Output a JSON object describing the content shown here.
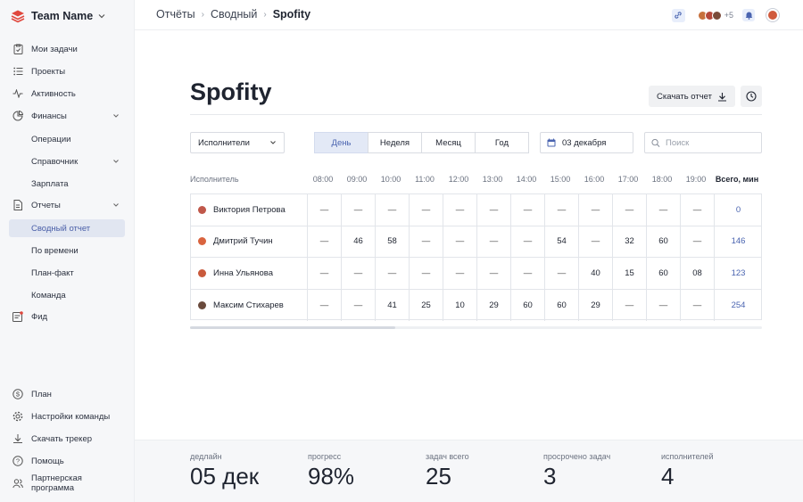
{
  "sidebar": {
    "team_name": "Team Name",
    "items": [
      {
        "label": "Мои задачи",
        "icon": "clipboard-icon"
      },
      {
        "label": "Проекты",
        "icon": "list-icon"
      },
      {
        "label": "Активность",
        "icon": "activity-icon"
      },
      {
        "label": "Финансы",
        "icon": "pie-icon"
      },
      {
        "label": "Операции"
      },
      {
        "label": "Справочник"
      },
      {
        "label": "Зарплата"
      },
      {
        "label": "Отчеты",
        "icon": "document-icon"
      },
      {
        "label": "Сводный отчет"
      },
      {
        "label": "По времени"
      },
      {
        "label": "План-факт"
      },
      {
        "label": "Команда"
      },
      {
        "label": "Фид",
        "icon": "feed-icon"
      }
    ],
    "bottom": [
      {
        "label": "План",
        "icon": "dollar-icon"
      },
      {
        "label": "Настройки команды",
        "icon": "gear-icon"
      },
      {
        "label": "Скачать трекер",
        "icon": "download-icon"
      },
      {
        "label": "Помощь",
        "icon": "help-icon"
      },
      {
        "label": "Партнерская программа",
        "icon": "users-icon"
      }
    ]
  },
  "topbar": {
    "breadcrumbs": [
      "Отчёты",
      "Сводный",
      "Spofity"
    ],
    "more_count": "+5"
  },
  "main": {
    "title": "Spofity",
    "download_label": "Скачать отчет",
    "filter_select": "Исполнители",
    "periods": [
      "День",
      "Неделя",
      "Месяц",
      "Год"
    ],
    "active_period": "День",
    "date": "03 декабря",
    "search_placeholder": "Поиск"
  },
  "table": {
    "headers": [
      "Исполнитель",
      "08:00",
      "09:00",
      "10:00",
      "11:00",
      "12:00",
      "13:00",
      "14:00",
      "15:00",
      "16:00",
      "17:00",
      "18:00",
      "19:00",
      "Всего, мин"
    ],
    "rows": [
      {
        "name": "Виктория Петрова",
        "values": [
          "—",
          "—",
          "—",
          "—",
          "—",
          "—",
          "—",
          "—",
          "—",
          "—",
          "—",
          "—"
        ],
        "total": "0",
        "color": "#c0584a"
      },
      {
        "name": "Дмитрий Тучин",
        "values": [
          "—",
          "46",
          "58",
          "—",
          "—",
          "—",
          "—",
          "54",
          "—",
          "32",
          "60",
          "—"
        ],
        "total": "146",
        "color": "#d9643f"
      },
      {
        "name": "Инна Ульянова",
        "values": [
          "—",
          "—",
          "—",
          "—",
          "—",
          "—",
          "—",
          "—",
          "40",
          "15",
          "60",
          "08"
        ],
        "total": "123",
        "color": "#c95a3c"
      },
      {
        "name": "Максим Стихарев",
        "values": [
          "—",
          "—",
          "41",
          "25",
          "10",
          "29",
          "60",
          "60",
          "29",
          "—",
          "—",
          "—"
        ],
        "total": "254",
        "color": "#6a4a3c"
      }
    ]
  },
  "footer": {
    "stats": [
      {
        "label": "дедлайн",
        "value": "05 дек"
      },
      {
        "label": "прогресс",
        "value": "98%"
      },
      {
        "label": "задач всего",
        "value": "25"
      },
      {
        "label": "просрочено задач",
        "value": "3"
      },
      {
        "label": "исполнителей",
        "value": "4"
      }
    ]
  },
  "colors": {
    "accent": "#4a64b0",
    "active_bg": "#e1e6f1",
    "logo": "#e0483e"
  }
}
